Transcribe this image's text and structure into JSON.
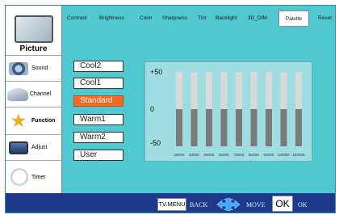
{
  "sidebar": {
    "items": [
      {
        "label": "Picture",
        "icon": "tv-icon",
        "active": true
      },
      {
        "label": "Sound",
        "icon": "speaker-icon"
      },
      {
        "label": "Channel",
        "icon": "satellite-dish-icon"
      },
      {
        "label": "Function",
        "icon": "star-icon"
      },
      {
        "label": "Adjust",
        "icon": "monitor-icon"
      },
      {
        "label": "Timer",
        "icon": "clock-icon"
      }
    ]
  },
  "tabs": [
    "Contrast",
    "Brightness",
    "Color",
    "Sharpness",
    "Tint",
    "Backlight",
    "3D_DIM",
    "Palette",
    "Reset"
  ],
  "active_tab": "Palette",
  "presets": [
    "Cool2",
    "Cool1",
    "Standard",
    "Warm1",
    "Warm2",
    "User"
  ],
  "selected_preset": "Standard",
  "chart_data": {
    "type": "bar",
    "categories": [
      "2500K",
      "3300K",
      "5600K",
      "6500K",
      "7300K",
      "8500K",
      "9300K",
      "12000K",
      "15000K"
    ],
    "values": [
      0,
      0,
      0,
      0,
      0,
      0,
      0,
      0,
      0
    ],
    "ylim": [
      -50,
      50
    ],
    "yticks": [
      "+50",
      "0",
      "-50"
    ]
  },
  "bottom_bar": {
    "menu_button": "TV.MENU",
    "back": "BACK",
    "move": "MOVE",
    "ok_button": "OK",
    "ok": "OK"
  },
  "colors": {
    "background": "#4fc9cf",
    "selected": "#f26a21",
    "bottom_bar": "#1d3b8a",
    "bar_upper": "#d9d9d9",
    "bar_lower": "#7a7a7a"
  }
}
